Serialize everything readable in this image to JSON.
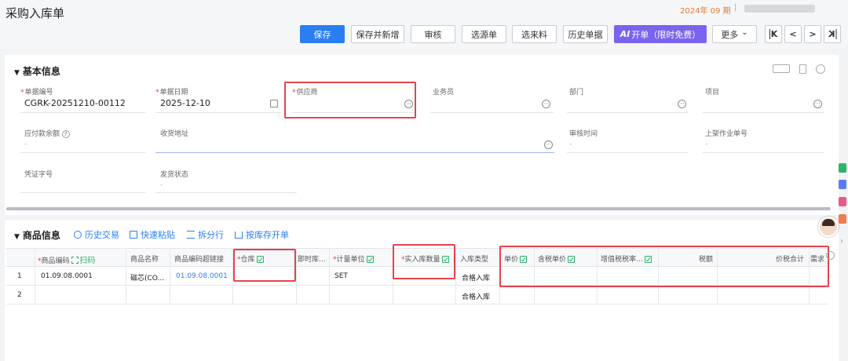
{
  "header": {
    "title": "采购入库单",
    "period": "2024年 09 期",
    "separator": "|"
  },
  "toolbar": {
    "save": "保存",
    "save_new": "保存并新增",
    "audit": "审核",
    "select_source": "选源单",
    "select_material": "选来料",
    "history": "历史单据",
    "ai_open": "开单（限时免费）",
    "ai_logo": "AI",
    "more": "更多",
    "more_caret": "⌄",
    "nav_first": "K",
    "nav_prev": "<",
    "nav_next": ">",
    "nav_last": "K"
  },
  "basic": {
    "title": "基本信息",
    "caret": "▼",
    "doc_no_label": "单据编号",
    "doc_no": "CGRK-20251210-00112",
    "doc_date_label": "单据日期",
    "doc_date": "2025-12-10",
    "supplier_label": "供应商",
    "salesperson_label": "业务员",
    "dept_label": "部门",
    "project_label": "项目",
    "payable_label": "应付款余额",
    "payable_value": "-",
    "address_label": "收货地址",
    "audit_time_label": "审核时间",
    "audit_time_value": "-",
    "shelf_label": "上架作业单号",
    "shelf_value": "-",
    "voucher_label": "凭证字号",
    "ship_status_label": "发货状态",
    "ship_status_value": "-",
    "required_mark": "*",
    "help_mark": "?",
    "dots": "⋯"
  },
  "goods": {
    "title": "商品信息",
    "caret": "▼",
    "tools": [
      "历史交易",
      "快速粘贴",
      "拆分行",
      "按库存开单"
    ],
    "tool_icons": [
      "clock-icon",
      "paste-icon",
      "split-icon",
      "home-icon"
    ],
    "columns": {
      "code": "商品编码",
      "scan": "扫码",
      "name": "商品名称",
      "link": "商品编码超链接",
      "warehouse": "仓库",
      "instock": "即时库...",
      "unit": "计量单位",
      "qty": "实入库数量",
      "intype": "入库类型",
      "price": "单价",
      "taxprice": "含税单价",
      "taxrate": "增值税税率...",
      "tax": "税额",
      "total": "价税合计",
      "extra": "需求"
    },
    "rows": [
      {
        "no": "1",
        "code": "01.09.08.0001",
        "name": "磁芯(CO...",
        "link": "01.09.08.0001",
        "unit": "SET",
        "intype": "合格入库"
      },
      {
        "no": "2",
        "code": "",
        "name": "",
        "link": "",
        "unit": "",
        "intype": "合格入库"
      }
    ]
  },
  "colors": {
    "primary": "#2a7ef4",
    "ai": "#7b63f0",
    "highlight": "#e2444a",
    "period": "#e07a2e"
  }
}
